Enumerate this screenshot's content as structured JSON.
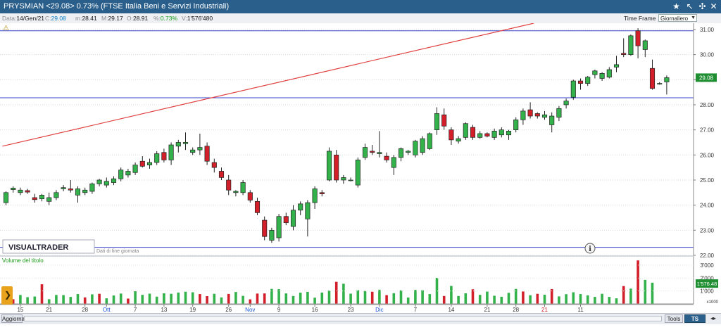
{
  "window": {
    "title": "PRYSMIAN <29.08> 0.73%  (FTSE Italia Beni e Servizi Industriali)"
  },
  "infobar": {
    "date_label": "Data:",
    "date_value": "14/Gen/21",
    "close_label": "C:",
    "close_value": "29.08",
    "low_label": "m:",
    "low_value": "28.41",
    "high_label": "M:",
    "high_value": "29.17",
    "open_label": "O:",
    "open_value": "28.91",
    "pct_label": "%:",
    "pct_value": "0.73%",
    "vol_label": "V:",
    "vol_value": "1'576'480",
    "timeframe_label": "Time Frame",
    "timeframe_value": "Giornaliero"
  },
  "branding": {
    "name": "VISUALTRADER",
    "subtitle": "Dati di fine giornata"
  },
  "volume_pane": {
    "label": "Volume del titolo",
    "unit_label": "x1000",
    "current_value": "1'576.48"
  },
  "price_axis": {
    "ticks": [
      "31.00",
      "30.00",
      "29.00",
      "28.00",
      "27.00",
      "26.00",
      "25.00",
      "24.00",
      "23.00",
      "22.00"
    ],
    "current_label": "29.08"
  },
  "volume_axis": {
    "ticks": [
      "3'000",
      "2'000",
      "1'000"
    ]
  },
  "x_axis": {
    "labels": [
      "15",
      "21",
      "28",
      "Ott",
      "7",
      "13",
      "19",
      "26",
      "Nov",
      "9",
      "16",
      "23",
      "Dic",
      "7",
      "14",
      "21",
      "28",
      "21",
      "11"
    ]
  },
  "bottombar": {
    "update_label": "Aggiorna",
    "tools_label": "Tools",
    "tsoff_label": "TS OFF"
  },
  "colors": {
    "up": "#33b14b",
    "down": "#d21f2a",
    "trend": "#e04040",
    "hline": "#3a45c8",
    "highlight_date": "#d21f2a",
    "month_label": "#1e55d8"
  },
  "chart_data": {
    "type": "candlestick",
    "ylim": [
      22.0,
      31.25
    ],
    "volume_ylim": [
      0,
      3600
    ],
    "series_ohlc": [
      [
        24.1,
        24.55,
        24.0,
        24.5
      ],
      [
        24.62,
        24.75,
        24.5,
        24.68
      ],
      [
        24.5,
        24.7,
        24.4,
        24.6
      ],
      [
        24.58,
        24.65,
        24.45,
        24.52
      ],
      [
        24.3,
        24.45,
        24.1,
        24.22
      ],
      [
        24.25,
        24.45,
        24.15,
        24.4
      ],
      [
        24.15,
        24.5,
        24.0,
        24.3
      ],
      [
        24.3,
        24.6,
        24.2,
        24.5
      ],
      [
        24.65,
        24.8,
        24.55,
        24.7
      ],
      [
        24.65,
        25.0,
        24.5,
        24.6
      ],
      [
        24.4,
        24.75,
        24.1,
        24.65
      ],
      [
        24.5,
        24.7,
        24.4,
        24.6
      ],
      [
        24.55,
        24.9,
        24.45,
        24.85
      ],
      [
        24.85,
        25.05,
        24.75,
        25.0
      ],
      [
        24.8,
        25.1,
        24.7,
        24.95
      ],
      [
        24.9,
        25.15,
        24.8,
        25.05
      ],
      [
        25.05,
        25.5,
        24.95,
        25.4
      ],
      [
        25.2,
        25.45,
        25.1,
        25.35
      ],
      [
        25.3,
        25.7,
        25.2,
        25.6
      ],
      [
        25.75,
        25.95,
        25.5,
        25.55
      ],
      [
        25.6,
        25.85,
        25.45,
        25.7
      ],
      [
        25.7,
        26.15,
        25.6,
        26.05
      ],
      [
        26.1,
        26.25,
        25.7,
        25.8
      ],
      [
        25.8,
        26.5,
        25.6,
        26.4
      ],
      [
        26.35,
        26.6,
        26.1,
        26.5
      ],
      [
        26.45,
        26.9,
        26.2,
        26.5
      ],
      [
        26.1,
        26.3,
        26.0,
        26.2
      ],
      [
        26.2,
        26.85,
        26.0,
        26.3
      ],
      [
        26.35,
        26.5,
        25.6,
        25.75
      ],
      [
        25.7,
        25.85,
        25.3,
        25.5
      ],
      [
        25.35,
        25.5,
        25.0,
        25.1
      ],
      [
        25.0,
        25.2,
        24.4,
        24.6
      ],
      [
        24.5,
        24.6,
        24.35,
        24.55
      ],
      [
        24.5,
        25.0,
        24.4,
        24.9
      ],
      [
        24.5,
        24.6,
        24.1,
        24.2
      ],
      [
        24.15,
        24.3,
        23.6,
        23.7
      ],
      [
        23.4,
        23.55,
        22.6,
        22.75
      ],
      [
        22.6,
        23.1,
        22.5,
        23.0
      ],
      [
        22.7,
        23.65,
        22.55,
        23.55
      ],
      [
        23.55,
        23.7,
        23.2,
        23.3
      ],
      [
        23.15,
        24.0,
        23.0,
        23.8
      ],
      [
        23.8,
        24.15,
        23.6,
        24.05
      ],
      [
        23.45,
        24.2,
        22.75,
        24.1
      ],
      [
        24.1,
        24.75,
        23.85,
        24.65
      ],
      [
        24.5,
        24.6,
        24.35,
        24.45
      ],
      [
        25.0,
        26.3,
        24.95,
        26.15
      ],
      [
        26.0,
        26.2,
        24.9,
        25.0
      ],
      [
        25.0,
        25.2,
        24.85,
        25.1
      ],
      [
        25.0,
        25.1,
        24.95,
        25.0
      ],
      [
        24.8,
        25.9,
        24.7,
        25.8
      ],
      [
        25.9,
        26.45,
        25.8,
        26.3
      ],
      [
        26.15,
        26.4,
        26.0,
        26.1
      ],
      [
        26.05,
        26.95,
        25.9,
        26.1
      ],
      [
        25.95,
        26.1,
        25.7,
        25.8
      ],
      [
        25.5,
        26.0,
        25.2,
        25.9
      ],
      [
        25.9,
        26.3,
        25.75,
        26.25
      ],
      [
        26.1,
        26.2,
        26.0,
        26.15
      ],
      [
        26.0,
        26.6,
        25.9,
        26.55
      ],
      [
        26.1,
        26.75,
        26.0,
        26.65
      ],
      [
        26.25,
        26.9,
        26.2,
        26.85
      ],
      [
        27.0,
        27.9,
        26.8,
        27.65
      ],
      [
        27.6,
        27.85,
        27.0,
        27.15
      ],
      [
        27.0,
        27.1,
        26.4,
        26.6
      ],
      [
        26.55,
        26.75,
        26.45,
        26.65
      ],
      [
        26.7,
        27.3,
        26.6,
        27.25
      ],
      [
        27.1,
        27.2,
        26.6,
        26.7
      ],
      [
        26.7,
        26.95,
        26.65,
        26.85
      ],
      [
        26.85,
        26.9,
        26.7,
        26.75
      ],
      [
        26.7,
        27.05,
        26.6,
        26.95
      ],
      [
        26.8,
        27.1,
        26.7,
        27.0
      ],
      [
        26.8,
        27.0,
        26.6,
        26.95
      ],
      [
        27.0,
        27.5,
        26.9,
        27.4
      ],
      [
        27.4,
        27.85,
        27.2,
        27.75
      ],
      [
        27.8,
        28.1,
        27.45,
        27.55
      ],
      [
        27.65,
        27.7,
        27.45,
        27.55
      ],
      [
        27.5,
        27.75,
        27.4,
        27.6
      ],
      [
        27.2,
        27.7,
        26.9,
        27.55
      ],
      [
        27.5,
        27.95,
        27.35,
        27.85
      ],
      [
        28.0,
        28.25,
        27.85,
        28.15
      ],
      [
        28.3,
        29.0,
        28.2,
        28.95
      ],
      [
        28.95,
        29.05,
        28.6,
        28.85
      ],
      [
        28.85,
        29.15,
        28.75,
        29.1
      ],
      [
        29.2,
        29.4,
        29.05,
        29.35
      ],
      [
        29.05,
        29.3,
        28.95,
        29.25
      ],
      [
        29.1,
        29.5,
        29.05,
        29.4
      ],
      [
        29.5,
        29.95,
        29.3,
        29.6
      ],
      [
        30.05,
        30.65,
        29.9,
        30.0
      ],
      [
        30.0,
        30.8,
        29.95,
        30.75
      ],
      [
        30.95,
        31.05,
        29.85,
        30.35
      ],
      [
        30.2,
        30.6,
        29.9,
        30.55
      ],
      [
        29.45,
        29.8,
        28.6,
        28.65
      ],
      [
        28.85,
        28.9,
        28.8,
        28.85
      ],
      [
        28.91,
        29.17,
        28.41,
        29.08
      ]
    ],
    "volumes": [
      430,
      360,
      690,
      520,
      570,
      1520,
      360,
      690,
      680,
      540,
      760,
      500,
      740,
      780,
      430,
      650,
      800,
      410,
      980,
      700,
      790,
      560,
      820,
      780,
      880,
      940,
      900,
      760,
      600,
      780,
      500,
      770,
      920,
      620,
      350,
      800,
      810,
      1160,
      1140,
      810,
      610,
      870,
      930,
      480,
      880,
      1030,
      1710,
      1560,
      790,
      1060,
      1000,
      940,
      1100,
      680,
      830,
      1050,
      490,
      1090,
      1060,
      760,
      2020,
      610,
      1390,
      610,
      820,
      1130,
      700,
      950,
      630,
      550,
      860,
      1160,
      960,
      670,
      780,
      710,
      1150,
      580,
      750,
      900,
      760,
      660,
      540,
      780,
      540,
      430,
      1380,
      1180,
      3370,
      1860,
      1640
    ],
    "down_volume_indices": [
      1,
      5,
      11,
      13,
      17,
      27,
      28,
      31,
      34,
      35,
      36,
      46,
      51,
      53,
      61,
      65,
      72,
      74,
      76,
      86,
      88
    ],
    "volume_color_overrides": [
      [
        86,
        "down"
      ],
      [
        88,
        "down"
      ]
    ],
    "h_lines": [
      30.95,
      28.28,
      22.32
    ],
    "trendline": {
      "from": [
        -0.5,
        26.35
      ],
      "to": [
        73.5,
        31.25
      ]
    },
    "x_label_indices": [
      2,
      6,
      11,
      14,
      18,
      22,
      26,
      31,
      34,
      38,
      43,
      48,
      52,
      57,
      62,
      67,
      71,
      75,
      80
    ]
  }
}
